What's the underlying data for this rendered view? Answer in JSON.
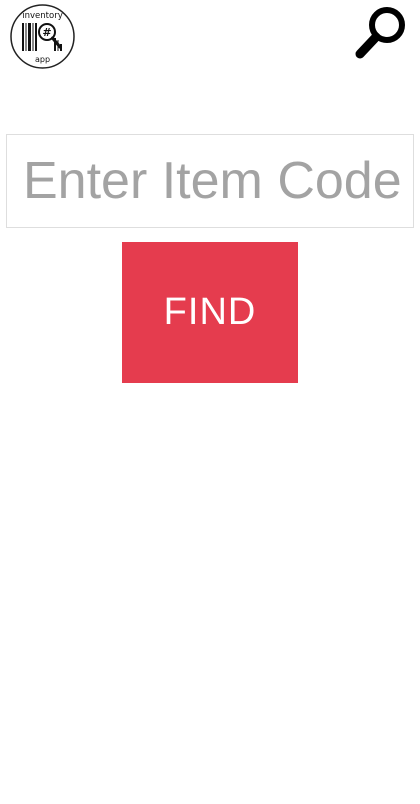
{
  "header": {
    "logo": {
      "icon": "inventory-app-logo",
      "text_top": "inventory",
      "text_bottom": "app",
      "symbol": "#"
    },
    "search_icon": "search-icon"
  },
  "search": {
    "placeholder": "Enter Item Code",
    "value": ""
  },
  "actions": {
    "find_label": "FIND"
  },
  "colors": {
    "accent": "#e53c4e",
    "background": "#ffffff",
    "placeholder": "#a3a3a3",
    "border": "#dedede"
  }
}
